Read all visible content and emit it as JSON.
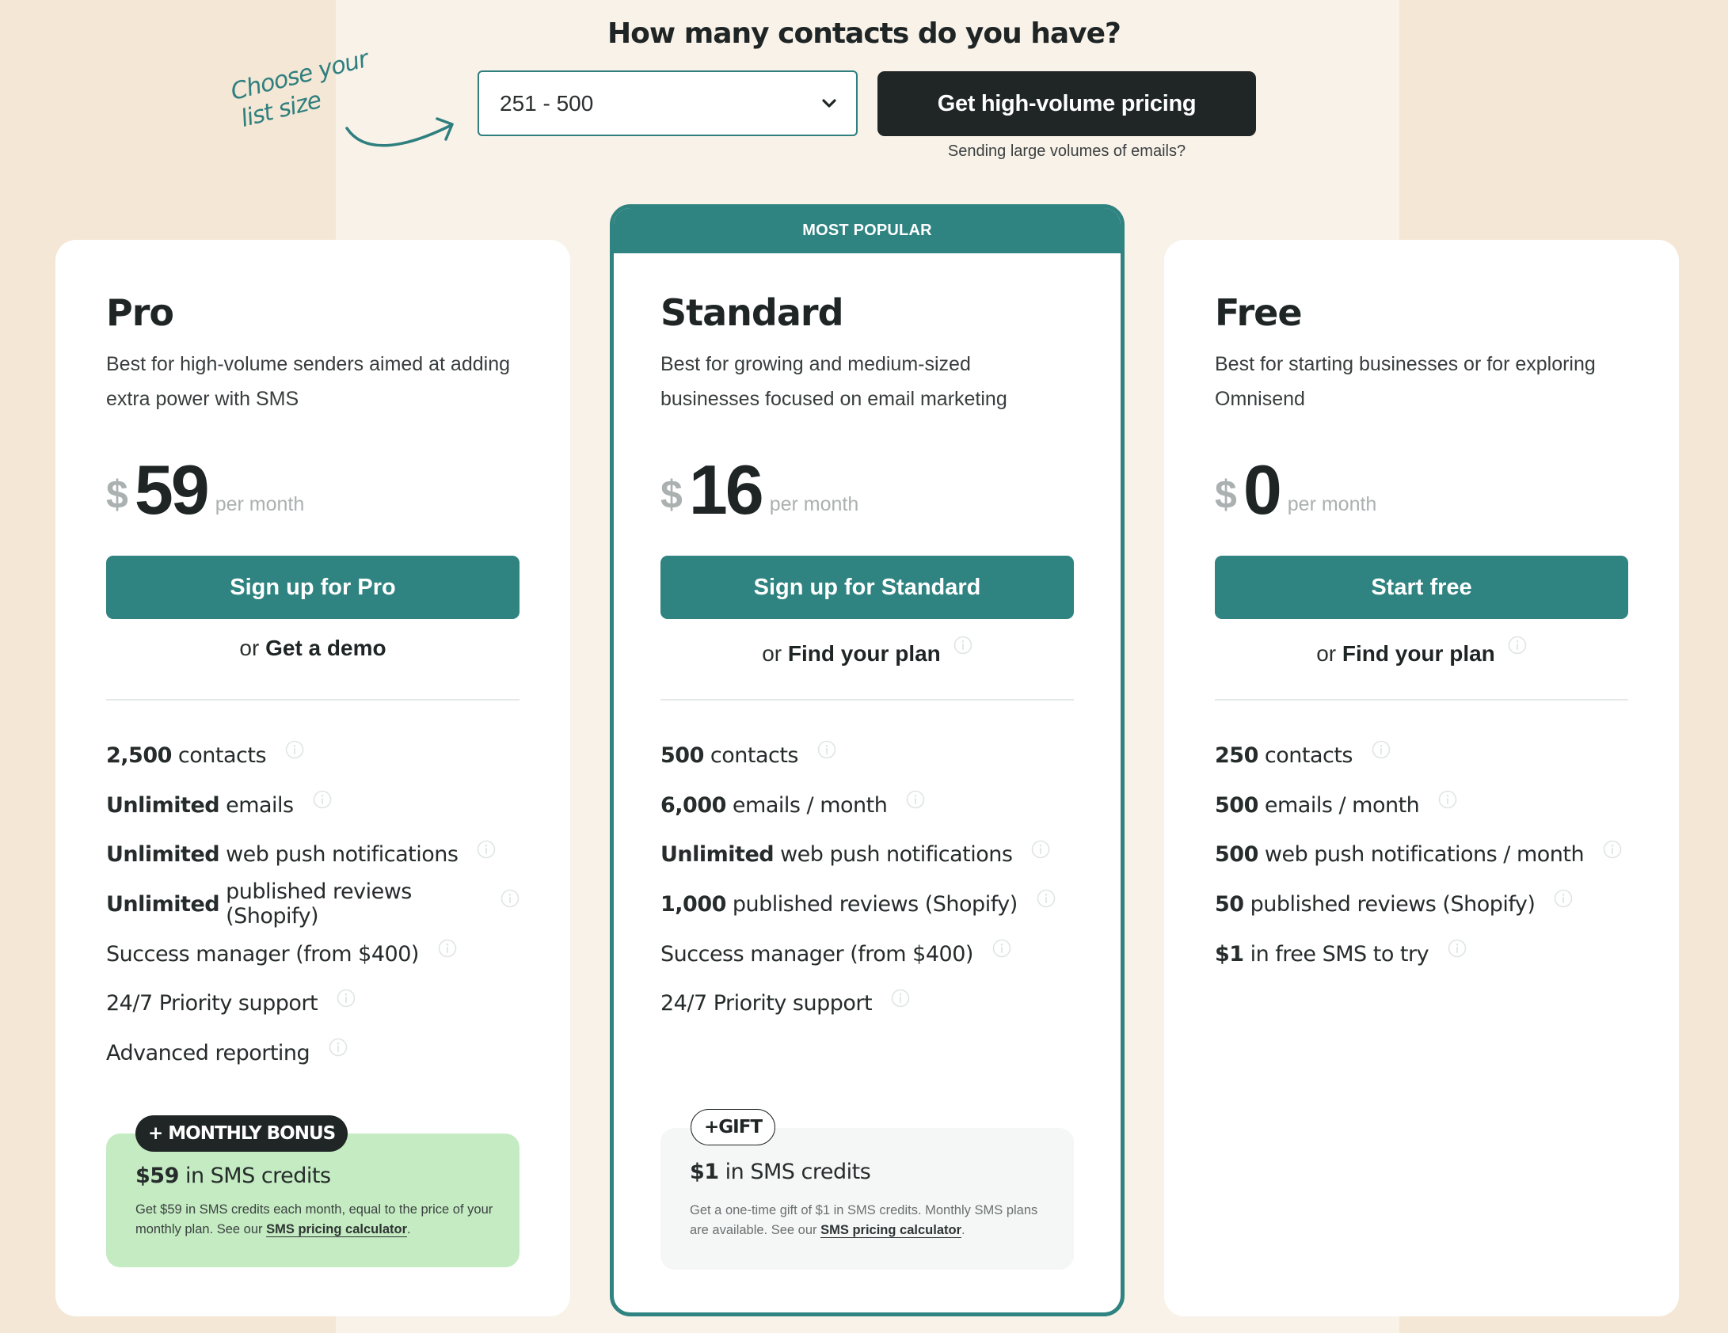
{
  "header": {
    "title": "How many contacts do you have?",
    "handnote_line1": "Choose your",
    "handnote_line2": "list size",
    "contacts_select": {
      "value": "251 - 500"
    },
    "high_volume_button": "Get high-volume pricing",
    "high_volume_subtext": "Sending large volumes of emails?"
  },
  "colors": {
    "accent": "#2f8380",
    "dark": "#202525",
    "bonus_bg": "#c4ebc1",
    "page_bg": "#f4e7d5",
    "band_bg": "#f9f2e9"
  },
  "plans": [
    {
      "name": "Pro",
      "description": "Best for high-volume senders aimed at adding extra power with SMS",
      "currency": "$",
      "price": "59",
      "period": "per month",
      "cta": "Sign up for Pro",
      "or_prefix": "or",
      "or_link": "Get a demo",
      "features": [
        {
          "bold": "2,500",
          "text": "contacts"
        },
        {
          "bold": "Unlimited",
          "text": "emails"
        },
        {
          "bold": "Unlimited",
          "text": "web push notifications"
        },
        {
          "bold": "Unlimited",
          "text": "published reviews (Shopify)"
        },
        {
          "bold": "",
          "text": "Success manager (from $400)"
        },
        {
          "bold": "",
          "text": "24/7 Priority support"
        },
        {
          "bold": "",
          "text": "Advanced reporting"
        }
      ],
      "extra": {
        "badge": "+ MONTHLY BONUS",
        "title_bold": "$59",
        "title_rest": "in SMS credits",
        "text": "Get $59 in SMS credits each month, equal to the price of your monthly plan. See our",
        "link": "SMS pricing calculator",
        "suffix": "."
      }
    },
    {
      "name": "Standard",
      "badge": "MOST POPULAR",
      "description": "Best for growing and medium-sized businesses focused on email marketing",
      "currency": "$",
      "price": "16",
      "period": "per month",
      "cta": "Sign up for Standard",
      "or_prefix": "or",
      "or_link": "Find your plan",
      "features": [
        {
          "bold": "500",
          "text": "contacts"
        },
        {
          "bold": "6,000",
          "text": "emails / month"
        },
        {
          "bold": "Unlimited",
          "text": "web push notifications"
        },
        {
          "bold": "1,000",
          "text": "published reviews (Shopify)"
        },
        {
          "bold": "",
          "text": "Success manager (from $400)"
        },
        {
          "bold": "",
          "text": "24/7 Priority support"
        }
      ],
      "extra": {
        "badge": "+GIFT",
        "title_bold": "$1",
        "title_rest": "in SMS credits",
        "text": "Get a one-time gift of $1 in SMS credits. Monthly SMS plans are available. See our",
        "link": "SMS pricing calculator",
        "suffix": "."
      }
    },
    {
      "name": "Free",
      "description": "Best for starting businesses or for exploring Omnisend",
      "currency": "$",
      "price": "0",
      "period": "per month",
      "cta": "Start free",
      "or_prefix": "or",
      "or_link": "Find your plan",
      "features": [
        {
          "bold": "250",
          "text": "contacts"
        },
        {
          "bold": "500",
          "text": "emails / month"
        },
        {
          "bold": "500",
          "text": "web push notifications / month"
        },
        {
          "bold": "50",
          "text": "published reviews (Shopify)"
        },
        {
          "bold": "$1",
          "text": "in free SMS to try"
        }
      ]
    }
  ]
}
